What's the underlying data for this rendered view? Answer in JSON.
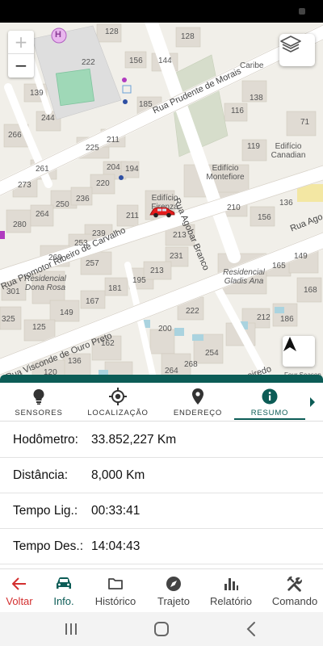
{
  "map": {
    "zoom_in": "+",
    "zoom_out": "−",
    "hospital_symbol": "H",
    "streets": [
      "Rua Prudente de Morais",
      "Rua Promotor Ribeiro de Carvalho",
      "Rua Agobar Branco",
      "Rua Visconde de Ouro Preto",
      "Rua Ago",
      "queiredo"
    ],
    "places": [
      "Edifício Canadian",
      "Edifício Montefiore",
      "Edifício Firenza",
      "Residencial Dona Rosa",
      "Residencial Gladis Ana",
      "Caribe",
      "Four Season"
    ],
    "house_numbers": [
      "128",
      "128",
      "222",
      "156",
      "144",
      "139",
      "185",
      "138",
      "244",
      "116",
      "266",
      "71",
      "225",
      "211",
      "119",
      "261",
      "204",
      "194",
      "220",
      "273",
      "250",
      "236",
      "210",
      "136",
      "280",
      "264",
      "211",
      "156",
      "239",
      "213",
      "253",
      "149",
      "269",
      "257",
      "231",
      "165",
      "301",
      "195",
      "213",
      "181",
      "167",
      "149",
      "168",
      "325",
      "125",
      "222",
      "212",
      "186",
      "200",
      "162",
      "254",
      "136",
      "120",
      "268",
      "264"
    ],
    "car_marker": "car-marker",
    "colors": {
      "background": "#f1efe9",
      "building": "#e0dbd3",
      "road": "#ffffff",
      "park": "#b7e0c3",
      "grass": "#d4dcc9",
      "water": "#aad3df"
    }
  },
  "tabs": [
    {
      "label": "SENSORES",
      "icon": "bulb-icon",
      "active": false
    },
    {
      "label": "LOCALIZAÇÃO",
      "icon": "gps-target-icon",
      "active": false
    },
    {
      "label": "ENDEREÇO",
      "icon": "map-pin-icon",
      "active": false
    },
    {
      "label": "RESUMO",
      "icon": "info-icon",
      "active": true
    }
  ],
  "summary": [
    {
      "label": "Hodômetro:",
      "value": "33.852,227 Km"
    },
    {
      "label": "Distância:",
      "value": "8,000 Km"
    },
    {
      "label": "Tempo Lig.:",
      "value": "00:33:41"
    },
    {
      "label": "Tempo Des.:",
      "value": "14:04:43"
    }
  ],
  "bottom_nav": [
    {
      "label": "Voltar",
      "icon": "arrow-left-icon"
    },
    {
      "label": "Info.",
      "icon": "car-icon"
    },
    {
      "label": "Histórico",
      "icon": "folder-icon"
    },
    {
      "label": "Trajeto",
      "icon": "compass-icon"
    },
    {
      "label": "Relatório",
      "icon": "bar-chart-icon"
    },
    {
      "label": "Comando",
      "icon": "tools-icon"
    }
  ],
  "theme": {
    "primary": "#0c5c56",
    "back_color": "#d32f2f"
  }
}
